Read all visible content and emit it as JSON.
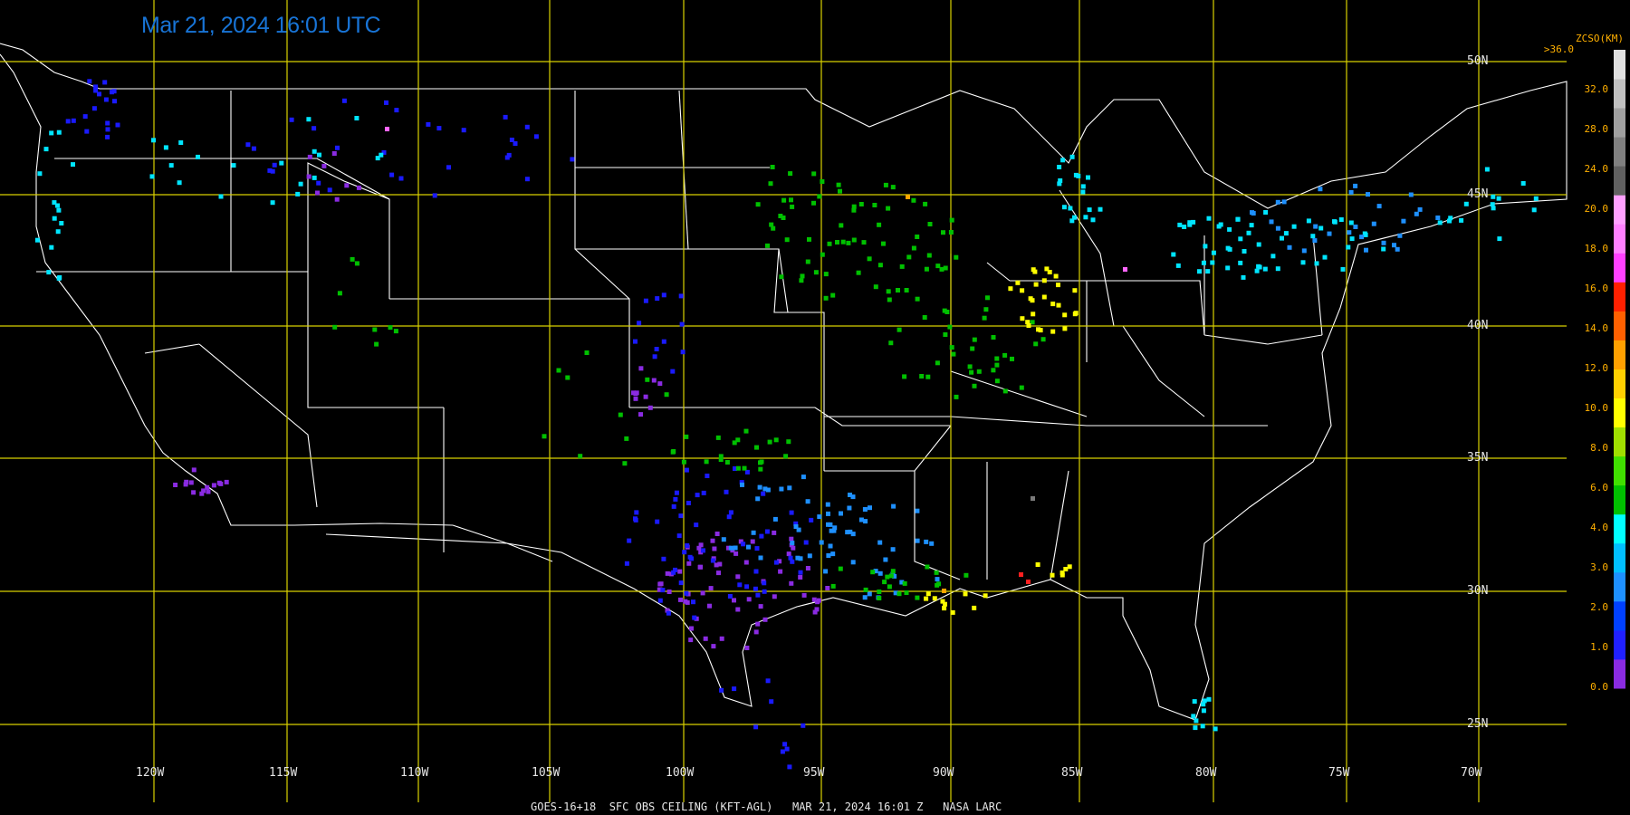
{
  "header": {
    "timestamp": "Mar 21, 2024 16:01 UTC"
  },
  "footer": {
    "caption": "GOES-16+18  SFC OBS CEILING (KFT-AGL)   MAR 21, 2024 16:01 Z   NASA LARC"
  },
  "map": {
    "lon_labels": [
      "120W",
      "115W",
      "110W",
      "105W",
      "100W",
      "95W",
      "90W",
      "85W",
      "80W",
      "75W",
      "70W"
    ],
    "lat_labels": [
      "50N",
      "45N",
      "40N",
      "35N",
      "30N",
      "25N"
    ],
    "grid_color": "#d8d000",
    "border_color": "#ffffff"
  },
  "colorbar": {
    "title": "ZCSO(KM)",
    "top_label": ">36.0",
    "ticks": [
      "32.0",
      "28.0",
      "24.0",
      "20.0",
      "18.0",
      "16.0",
      "14.0",
      "12.0",
      "10.0",
      "8.0",
      "6.0",
      "4.0",
      "3.0",
      "2.0",
      "1.0",
      "0.0"
    ],
    "colors": [
      "#8a2be2",
      "#2020ff",
      "#0040ff",
      "#1e90ff",
      "#00bfff",
      "#00ffff",
      "#00c000",
      "#40e000",
      "#a0e000",
      "#ffff00",
      "#ffd000",
      "#ffa000",
      "#ff6000",
      "#ff2000",
      "#ff40ff",
      "#ff80ff",
      "#ffa0ff",
      "#606060",
      "#808080",
      "#a0a0a0",
      "#c0c0c0",
      "#e0e0e0"
    ]
  },
  "stations": {
    "purple": "#8a2be2",
    "blue": "#1a1aff",
    "skyblue": "#1e90ff",
    "cyan": "#00e5ff",
    "green": "#00c000",
    "lime": "#7fdc00",
    "yellow": "#ffff00",
    "orange": "#ffa500",
    "red": "#ff2020",
    "pink": "#ff66ff",
    "gray": "#7a7a7a"
  }
}
